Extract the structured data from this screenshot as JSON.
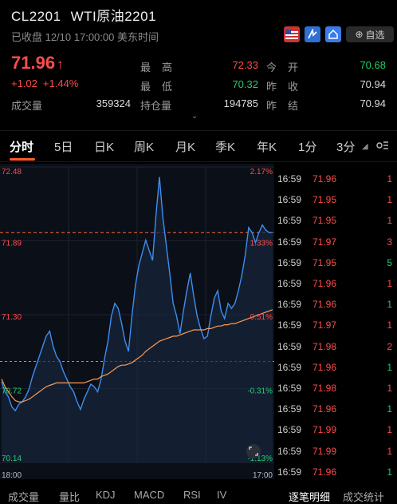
{
  "header": {
    "symbol": "CL2201",
    "name": "WTI原油2201",
    "status": "已收盘 12/10 17:00:00 美东时间",
    "watch_label": "自选",
    "watch_icon": "plus-icon",
    "icons": [
      "us-flag-icon",
      "level5-icon",
      "home-icon"
    ]
  },
  "quote": {
    "price": "71.96",
    "change": "+1.02",
    "change_pct": "+1.44%",
    "volume_label": "成交量",
    "volume": "359324",
    "fields": [
      {
        "label": "最高",
        "value": "72.33",
        "color": "#ff4b4b"
      },
      {
        "label": "今开",
        "value": "70.68",
        "color": "#1fcf6a"
      },
      {
        "label": "最低",
        "value": "70.32",
        "color": "#1fcf6a"
      },
      {
        "label": "昨收",
        "value": "70.94",
        "color": "#dddddd"
      },
      {
        "label": "持仓量",
        "value": "194785",
        "color": "#dddddd"
      },
      {
        "label": "昨结",
        "value": "70.94",
        "color": "#dddddd"
      }
    ]
  },
  "tabs": [
    "分时",
    "5日",
    "日K",
    "周K",
    "月K",
    "季K",
    "年K",
    "1分",
    "3分"
  ],
  "bottom_tabs": [
    "成交量",
    "量比",
    "KDJ",
    "MACD",
    "RSI",
    "IV",
    "逐笔明细",
    "成交统计"
  ],
  "chart_data": {
    "type": "line",
    "y_left_ticks": [
      "72.48",
      "71.89",
      "71.30",
      "70.72",
      "70.14"
    ],
    "y_right_ticks": [
      "2.17%",
      "1.33%",
      "0.51%",
      "-0.31%",
      "-1.13%"
    ],
    "x_ticks": [
      "18:00",
      "17:00"
    ],
    "ylim": [
      70.14,
      72.48
    ],
    "prev_close": 70.94,
    "upper_ref": 71.96,
    "series": [
      {
        "values": [
          70.78,
          70.7,
          70.66,
          70.58,
          70.55,
          70.6,
          70.62,
          70.66,
          70.72,
          70.82,
          70.9,
          70.98,
          71.06,
          71.14,
          71.18,
          71.06,
          70.98,
          70.94,
          70.86,
          70.8,
          70.74,
          70.7,
          70.62,
          70.56,
          70.64,
          70.7,
          70.76,
          70.74,
          70.7,
          70.8,
          70.96,
          71.1,
          71.3,
          71.4,
          71.36,
          71.24,
          71.1,
          71.02,
          71.3,
          71.54,
          71.7,
          71.8,
          71.9,
          71.82,
          71.74,
          72.1,
          72.4,
          72.08,
          71.86,
          71.64,
          71.4,
          71.3,
          71.16,
          71.34,
          71.5,
          71.64,
          71.46,
          71.3,
          71.2,
          71.12,
          71.14,
          71.3,
          71.44,
          71.5,
          71.34,
          71.28,
          71.4,
          71.36,
          71.4,
          71.5,
          71.62,
          71.78,
          72.0,
          71.96,
          71.88,
          71.96,
          72.02,
          71.98,
          71.96,
          71.96
        ]
      },
      {
        "values": [
          70.8,
          70.74,
          70.7,
          70.66,
          70.63,
          70.62,
          70.62,
          70.63,
          70.64,
          70.66,
          70.68,
          70.7,
          70.72,
          70.74,
          70.75,
          70.76,
          70.77,
          70.77,
          70.77,
          70.77,
          70.77,
          70.77,
          70.77,
          70.77,
          70.77,
          70.78,
          70.79,
          70.8,
          70.8,
          70.82,
          70.83,
          70.84,
          70.86,
          70.88,
          70.9,
          70.91,
          70.91,
          70.92,
          70.93,
          70.95,
          70.97,
          70.99,
          71.02,
          71.04,
          71.06,
          71.08,
          71.1,
          71.11,
          71.12,
          71.13,
          71.14,
          71.14,
          71.15,
          71.16,
          71.17,
          71.18,
          71.19,
          71.19,
          71.19,
          71.19,
          71.2,
          71.2,
          71.21,
          71.22,
          71.22,
          71.23,
          71.23,
          71.24,
          71.24,
          71.25,
          71.26,
          71.27,
          71.28,
          71.29,
          71.3,
          71.31,
          71.32,
          71.33,
          71.34,
          71.35
        ]
      }
    ],
    "colors": {
      "price": "#3d8ef0",
      "avg": "#ff9a55",
      "upper_ref": "#ff6a3a",
      "prev_ref": "#999999"
    }
  },
  "ticks": [
    {
      "time": "16:59",
      "price": "71.96",
      "vol": "1",
      "color": "#ff4b4b",
      "vcolor": "#ff4b4b"
    },
    {
      "time": "16:59",
      "price": "71.95",
      "vol": "1",
      "color": "#ff4b4b",
      "vcolor": "#ff4b4b"
    },
    {
      "time": "16:59",
      "price": "71.95",
      "vol": "1",
      "color": "#ff4b4b",
      "vcolor": "#ff4b4b"
    },
    {
      "time": "16:59",
      "price": "71.97",
      "vol": "3",
      "color": "#ff4b4b",
      "vcolor": "#ff4b4b"
    },
    {
      "time": "16:59",
      "price": "71.95",
      "vol": "5",
      "color": "#ff4b4b",
      "vcolor": "#1fcf6a"
    },
    {
      "time": "16:59",
      "price": "71.96",
      "vol": "1",
      "color": "#ff4b4b",
      "vcolor": "#ff4b4b"
    },
    {
      "time": "16:59",
      "price": "71.96",
      "vol": "1",
      "color": "#ff4b4b",
      "vcolor": "#1fcf6a"
    },
    {
      "time": "16:59",
      "price": "71.97",
      "vol": "1",
      "color": "#ff4b4b",
      "vcolor": "#ff4b4b"
    },
    {
      "time": "16:59",
      "price": "71.98",
      "vol": "2",
      "color": "#ff4b4b",
      "vcolor": "#ff4b4b"
    },
    {
      "time": "16:59",
      "price": "71.96",
      "vol": "1",
      "color": "#ff4b4b",
      "vcolor": "#1fcf6a"
    },
    {
      "time": "16:59",
      "price": "71.98",
      "vol": "1",
      "color": "#ff4b4b",
      "vcolor": "#ff4b4b"
    },
    {
      "time": "16:59",
      "price": "71.96",
      "vol": "1",
      "color": "#ff4b4b",
      "vcolor": "#1fcf6a"
    },
    {
      "time": "16:59",
      "price": "71.99",
      "vol": "1",
      "color": "#ff4b4b",
      "vcolor": "#ff4b4b"
    },
    {
      "time": "16:59",
      "price": "71.99",
      "vol": "1",
      "color": "#ff4b4b",
      "vcolor": "#ff4b4b"
    },
    {
      "time": "16:59",
      "price": "71.96",
      "vol": "1",
      "color": "#ff4b4b",
      "vcolor": "#1fcf6a"
    }
  ]
}
